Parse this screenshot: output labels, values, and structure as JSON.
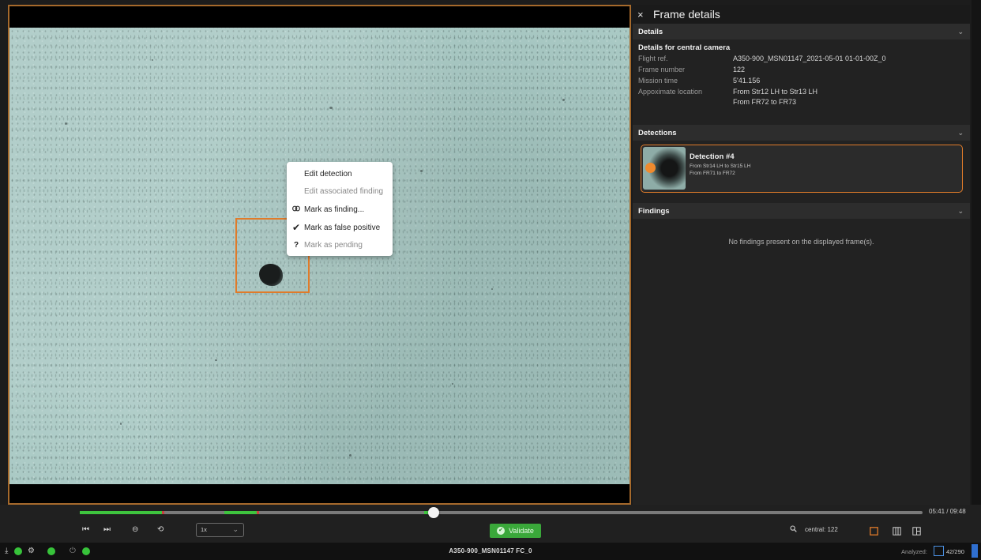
{
  "context_menu": {
    "items": [
      {
        "label": "Edit detection",
        "icon": "",
        "state": "enabled"
      },
      {
        "label": "Edit associated finding",
        "icon": "",
        "state": "disabled"
      },
      {
        "label": "Mark as finding...",
        "icon": "link-icon",
        "state": "enabled"
      },
      {
        "label": "Mark as false positive",
        "icon": "check-icon",
        "state": "enabled"
      },
      {
        "label": "Mark as pending",
        "icon": "question-icon",
        "state": "partly-disabled"
      }
    ]
  },
  "panel": {
    "close_glyph": "×",
    "title": "Frame details",
    "details": {
      "section_label": "Details",
      "subtitle": "Details for central camera",
      "rows": [
        {
          "key": "Flight ref.",
          "value": "A350-900_MSN01147_2021-05-01 01-01-00Z_0"
        },
        {
          "key": "Frame number",
          "value": "122"
        },
        {
          "key": "Mission time",
          "value": "5'41.156"
        },
        {
          "key": "Appoximate location",
          "value": "From Str12 LH to Str13 LH",
          "value2": "From FR72 to FR73"
        }
      ]
    },
    "detections": {
      "section_label": "Detections",
      "card": {
        "title": "Detection #4",
        "line1": "From Str14 LH to Str15 LH",
        "line2": "From FR71 to FR72"
      }
    },
    "findings": {
      "section_label": "Findings",
      "empty_text": "No findings present on the displayed frame(s)."
    }
  },
  "timeline": {
    "time_readout": "05:41 / 09:48",
    "playback_position": 0.42,
    "speed": "1x",
    "validate_label": "Validate",
    "camera_label": "central: 122"
  },
  "statusbar": {
    "title": "A350-900_MSN01147 FC_0",
    "analyzed_label": "Analyzed:",
    "analyzed_count": "42/290"
  },
  "colors": {
    "accent_orange": "#e07b2a",
    "status_green": "#37c33a",
    "validate_green": "#3aa83a",
    "selection_blue": "#2f6fd0",
    "panel_bg": "#222222"
  }
}
